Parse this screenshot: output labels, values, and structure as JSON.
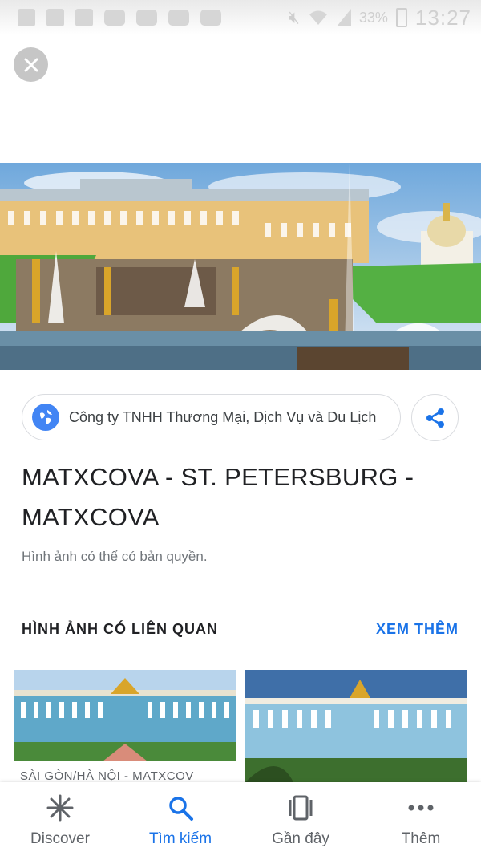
{
  "status_bar": {
    "battery": "33%",
    "time": "13:27"
  },
  "close": {
    "icon": "close-icon"
  },
  "hero": {
    "icon": "palace-fountains-image"
  },
  "source": {
    "text": "Công ty TNHH Thương Mại, Dịch Vụ và Du Lịch",
    "icon": "globe-icon"
  },
  "share": {
    "icon": "share-icon"
  },
  "result": {
    "title": "MATXCOVA - ST. PETERSBURG - MATXCOVA",
    "copyright": "Hình ảnh có thể có bản quyền."
  },
  "related": {
    "header": "HÌNH ẢNH CÓ LIÊN QUAN",
    "see_more": "XEM THÊM",
    "items": [
      {
        "caption": "SÀI GÒN/HÀ NỘI - MATXCOV"
      },
      {
        "caption": ""
      }
    ]
  },
  "bottom_nav": {
    "items": [
      {
        "label": "Discover",
        "icon": "asterisk-icon",
        "active": false
      },
      {
        "label": "Tìm kiếm",
        "icon": "search-icon",
        "active": true
      },
      {
        "label": "Gần đây",
        "icon": "recent-cards-icon",
        "active": false
      },
      {
        "label": "Thêm",
        "icon": "more-dots-icon",
        "active": false
      }
    ]
  },
  "colors": {
    "accent": "#1a73e8",
    "text_primary": "#202124",
    "text_secondary": "#70757a"
  }
}
